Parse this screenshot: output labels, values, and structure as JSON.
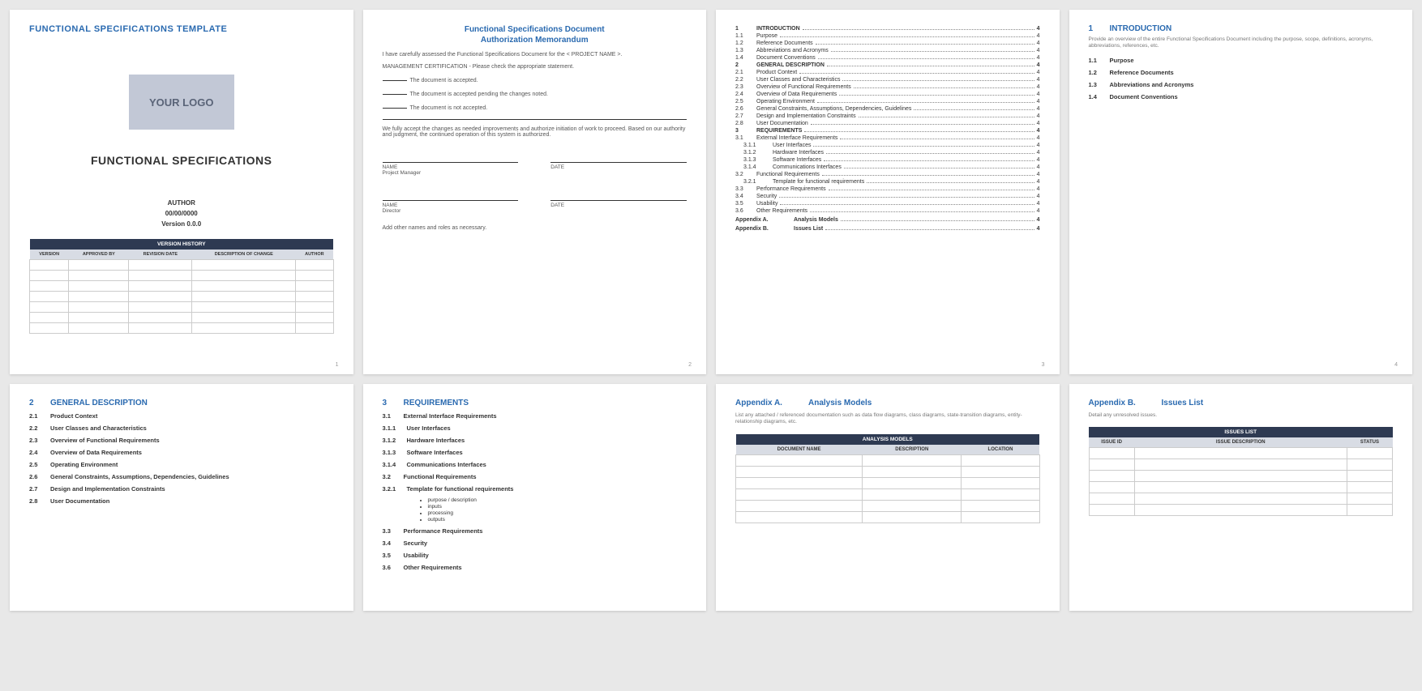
{
  "page1": {
    "template_title": "FUNCTIONAL SPECIFICATIONS TEMPLATE",
    "logo_placeholder": "YOUR LOGO",
    "doc_title": "FUNCTIONAL SPECIFICATIONS",
    "author": "AUTHOR",
    "date": "00/00/0000",
    "version": "Version 0.0.0",
    "vh_header": "VERSION HISTORY",
    "vh_cols": [
      "VERSION",
      "APPROVED BY",
      "REVISION DATE",
      "DESCRIPTION OF CHANGE",
      "AUTHOR"
    ],
    "pagenum": "1"
  },
  "page2": {
    "title1": "Functional Specifications Document",
    "title2": "Authorization Memorandum",
    "line1": "I have carefully assessed the Functional Specifications Document for the < PROJECT NAME >.",
    "line2": "MANAGEMENT CERTIFICATION - Please check the appropriate statement.",
    "opt1": "The document is accepted.",
    "opt2": "The document is accepted pending the changes noted.",
    "opt3": "The document is not accepted.",
    "accept": "We fully accept the changes as needed improvements and authorize initiation of work to proceed. Based on our authority and judgment, the continued operation of this system is authorized.",
    "name": "NAME",
    "date": "DATE",
    "role1": "Project Manager",
    "role2": "Director",
    "addnote": "Add other names and roles as necessary.",
    "pagenum": "2"
  },
  "page3": {
    "items": [
      {
        "n": "1",
        "t": "INTRODUCTION",
        "p": "4",
        "b": true
      },
      {
        "n": "1.1",
        "t": "Purpose",
        "p": "4"
      },
      {
        "n": "1.2",
        "t": "Reference Documents",
        "p": "4"
      },
      {
        "n": "1.3",
        "t": "Abbreviations and Acronyms",
        "p": "4"
      },
      {
        "n": "1.4",
        "t": "Document Conventions",
        "p": "4"
      },
      {
        "n": "2",
        "t": "GENERAL DESCRIPTION",
        "p": "4",
        "b": true
      },
      {
        "n": "2.1",
        "t": "Product Context",
        "p": "4"
      },
      {
        "n": "2.2",
        "t": "User Classes and Characteristics",
        "p": "4"
      },
      {
        "n": "2.3",
        "t": "Overview of Functional Requirements",
        "p": "4"
      },
      {
        "n": "2.4",
        "t": "Overview of Data Requirements",
        "p": "4"
      },
      {
        "n": "2.5",
        "t": "Operating Environment",
        "p": "4"
      },
      {
        "n": "2.6",
        "t": "General Constraints, Assumptions, Dependencies, Guidelines",
        "p": "4"
      },
      {
        "n": "2.7",
        "t": "Design and Implementation Constraints",
        "p": "4"
      },
      {
        "n": "2.8",
        "t": "User Documentation",
        "p": "4"
      },
      {
        "n": "3",
        "t": "REQUIREMENTS",
        "p": "4",
        "b": true
      },
      {
        "n": "3.1",
        "t": "External Interface Requirements",
        "p": "4"
      },
      {
        "n": "3.1.1",
        "t": "User Interfaces",
        "p": "4",
        "i": true
      },
      {
        "n": "3.1.2",
        "t": "Hardware Interfaces",
        "p": "4",
        "i": true
      },
      {
        "n": "3.1.3",
        "t": "Software Interfaces",
        "p": "4",
        "i": true
      },
      {
        "n": "3.1.4",
        "t": "Communications Interfaces",
        "p": "4",
        "i": true
      },
      {
        "n": "3.2",
        "t": "Functional Requirements",
        "p": "4"
      },
      {
        "n": "3.2.1",
        "t": "Template for functional requirements",
        "p": "4",
        "i": true
      },
      {
        "n": "3.3",
        "t": "Performance Requirements",
        "p": "4"
      },
      {
        "n": "3.4",
        "t": "Security",
        "p": "4"
      },
      {
        "n": "3.5",
        "t": "Usability",
        "p": "4"
      },
      {
        "n": "3.6",
        "t": "Other Requirements",
        "p": "4"
      }
    ],
    "appA": {
      "l": "Appendix A.",
      "t": "Analysis Models",
      "p": "4"
    },
    "appB": {
      "l": "Appendix B.",
      "t": "Issues List",
      "p": "4"
    },
    "pagenum": "3"
  },
  "page4": {
    "hn": "1",
    "ht": "INTRODUCTION",
    "desc": "Provide an overview of the entire Functional Specifications Document including the purpose, scope, definitions, acronyms, abbreviations, references, etc.",
    "items": [
      {
        "n": "1.1",
        "t": "Purpose"
      },
      {
        "n": "1.2",
        "t": "Reference Documents"
      },
      {
        "n": "1.3",
        "t": "Abbreviations and Acronyms"
      },
      {
        "n": "1.4",
        "t": "Document Conventions"
      }
    ],
    "pagenum": "4"
  },
  "page5": {
    "hn": "2",
    "ht": "GENERAL DESCRIPTION",
    "items": [
      {
        "n": "2.1",
        "t": "Product Context"
      },
      {
        "n": "2.2",
        "t": "User Classes and Characteristics"
      },
      {
        "n": "2.3",
        "t": "Overview of Functional Requirements"
      },
      {
        "n": "2.4",
        "t": "Overview of Data Requirements"
      },
      {
        "n": "2.5",
        "t": "Operating Environment"
      },
      {
        "n": "2.6",
        "t": "General Constraints, Assumptions, Dependencies, Guidelines"
      },
      {
        "n": "2.7",
        "t": "Design and Implementation Constraints"
      },
      {
        "n": "2.8",
        "t": "User Documentation"
      }
    ]
  },
  "page6": {
    "hn": "3",
    "ht": "REQUIREMENTS",
    "items": [
      {
        "n": "3.1",
        "t": "External Interface Requirements"
      },
      {
        "n": "3.1.1",
        "t": "User Interfaces",
        "sub": true
      },
      {
        "n": "3.1.2",
        "t": "Hardware Interfaces",
        "sub": true
      },
      {
        "n": "3.1.3",
        "t": "Software Interfaces",
        "sub": true
      },
      {
        "n": "3.1.4",
        "t": "Communications Interfaces",
        "sub": true
      },
      {
        "n": "3.2",
        "t": "Functional Requirements"
      },
      {
        "n": "3.2.1",
        "t": "Template for functional requirements",
        "sub": true,
        "bullets": [
          "purpose / description",
          "inputs",
          "processing",
          "outputs"
        ]
      },
      {
        "n": "3.3",
        "t": "Performance Requirements"
      },
      {
        "n": "3.4",
        "t": "Security"
      },
      {
        "n": "3.5",
        "t": "Usability"
      },
      {
        "n": "3.6",
        "t": "Other Requirements"
      }
    ]
  },
  "page7": {
    "ha": "Appendix A.",
    "ht": "Analysis Models",
    "desc": "List any attached / referenced documentation such as data flow diagrams, class diagrams, state-transition diagrams, entity-relationship diagrams, etc.",
    "thdr": "ANALYSIS MODELS",
    "cols": [
      "DOCUMENT NAME",
      "DESCRIPTION",
      "LOCATION"
    ]
  },
  "page8": {
    "ha": "Appendix B.",
    "ht": "Issues List",
    "desc": "Detail any unresolved issues.",
    "thdr": "ISSUES LIST",
    "cols": [
      "ISSUE ID",
      "ISSUE DESCRIPTION",
      "STATUS"
    ]
  }
}
